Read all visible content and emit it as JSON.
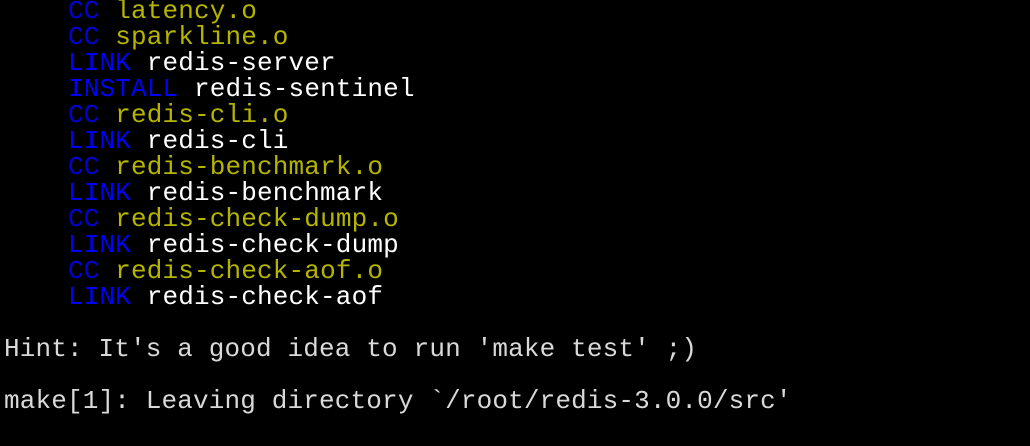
{
  "terminal": {
    "colors": {
      "background": "#000000",
      "tag_blue": "#0000ff",
      "object_yellow": "#b5b500",
      "binary_white": "#ffffff",
      "text_gray": "#d9d9d9"
    },
    "build_lines": [
      {
        "tag": "CC",
        "target": "latency.o"
      },
      {
        "tag": "CC",
        "target": "sparkline.o"
      },
      {
        "tag": "LINK",
        "target": "redis-server"
      },
      {
        "tag": "INSTALL",
        "target": "redis-sentinel"
      },
      {
        "tag": "CC",
        "target": "redis-cli.o"
      },
      {
        "tag": "LINK",
        "target": "redis-cli"
      },
      {
        "tag": "CC",
        "target": "redis-benchmark.o"
      },
      {
        "tag": "LINK",
        "target": "redis-benchmark"
      },
      {
        "tag": "CC",
        "target": "redis-check-dump.o"
      },
      {
        "tag": "LINK",
        "target": "redis-check-dump"
      },
      {
        "tag": "CC",
        "target": "redis-check-aof.o"
      },
      {
        "tag": "LINK",
        "target": "redis-check-aof"
      }
    ],
    "hint": "Hint: It's a good idea to run 'make test' ;)",
    "leaving": "make[1]: Leaving directory `/root/redis-3.0.0/src'"
  }
}
